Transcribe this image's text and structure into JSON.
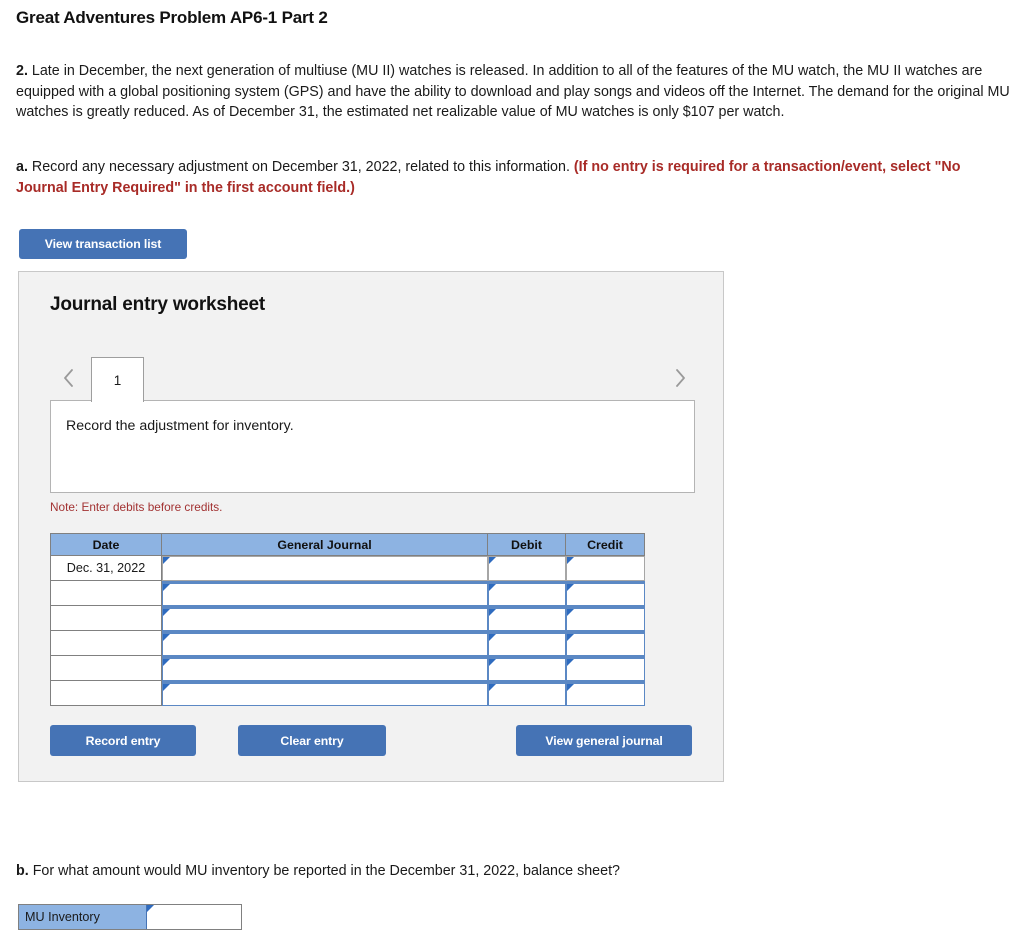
{
  "page": {
    "title": "Great Adventures Problem AP6-1 Part 2"
  },
  "problem": {
    "number": "2.",
    "text": " Late in December, the next generation of multiuse (MU II) watches is released. In addition to all of the features of the MU watch, the MU II watches are equipped with a global positioning system (GPS) and have the ability to download and play songs and videos off the Internet. The demand for the original MU watches is greatly reduced. As of December 31, the estimated net realizable value of MU watches is only $107 per watch."
  },
  "requirement_a": {
    "number": "a.",
    "text": " Record any necessary adjustment on December 31, 2022, related to this information. ",
    "red_text": "(If no entry is required for a transaction/event, select \"No Journal Entry Required\" in the first account field.)"
  },
  "toolbar": {
    "view_transaction_list_label": "View transaction list"
  },
  "worksheet": {
    "title": "Journal entry worksheet",
    "pager": {
      "prev_icon": "chevron-left-icon",
      "next_icon": "chevron-right-icon",
      "current_page": "1"
    },
    "description": "Record the adjustment for inventory.",
    "note": "Note: Enter debits before credits.",
    "table": {
      "columns": [
        "Date",
        "General Journal",
        "Debit",
        "Credit"
      ],
      "rows": [
        {
          "date": "Dec. 31, 2022",
          "general_journal": "",
          "debit": "",
          "credit": ""
        },
        {
          "date": "",
          "general_journal": "",
          "debit": "",
          "credit": ""
        },
        {
          "date": "",
          "general_journal": "",
          "debit": "",
          "credit": ""
        },
        {
          "date": "",
          "general_journal": "",
          "debit": "",
          "credit": ""
        },
        {
          "date": "",
          "general_journal": "",
          "debit": "",
          "credit": ""
        },
        {
          "date": "",
          "general_journal": "",
          "debit": "",
          "credit": ""
        }
      ]
    },
    "buttons": {
      "record_entry_label": "Record entry",
      "clear_entry_label": "Clear entry",
      "view_general_journal_label": "View general journal"
    }
  },
  "requirement_b": {
    "number": "b.",
    "text": " For what amount would MU inventory be reported in the December 31, 2022, balance sheet?",
    "answer_label": "MU Inventory",
    "answer_value": ""
  },
  "colors": {
    "button_blue": "#4573b5",
    "header_blue": "#8db3e2",
    "panel_gray": "#f2f2f2",
    "note_red": "#a23232",
    "instruction_red": "#a82b27",
    "field_border_blue": "#5b88c4"
  }
}
